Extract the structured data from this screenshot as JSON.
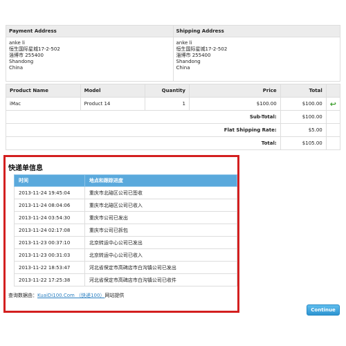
{
  "addresses": {
    "payment_header": "Payment Address",
    "shipping_header": "Shipping Address",
    "payment": [
      "anke li",
      "恒生国际星城17-2-502",
      "淄博市 255400",
      "Shandong",
      "China"
    ],
    "shipping": [
      "anke li",
      "恒生国际星城17-2-502",
      "淄博市 255400",
      "Shandong",
      "China"
    ]
  },
  "order": {
    "headers": {
      "product": "Product Name",
      "model": "Model",
      "quantity": "Quantity",
      "price": "Price",
      "total": "Total"
    },
    "item": {
      "product": "iMac",
      "model": "Product 14",
      "quantity": "1",
      "price": "$100.00",
      "total": "$100.00",
      "action_icon": "return-icon"
    },
    "totals": [
      {
        "label": "Sub-Total:",
        "value": "$100.00"
      },
      {
        "label": "Flat Shipping Rate:",
        "value": "$5.00"
      },
      {
        "label": "Total:",
        "value": "$105.00"
      }
    ]
  },
  "tracking": {
    "title": "快递单信息",
    "col_time": "时间",
    "col_progress": "地点和跟踪进度",
    "rows": [
      {
        "time": "2013-11-24 19:45:04",
        "status": "重庆市北碚区公司已签收"
      },
      {
        "time": "2013-11-24 08:04:06",
        "status": "重庆市北碚区公司已收入"
      },
      {
        "time": "2013-11-24 03:54:30",
        "status": "重庆市公司已发出"
      },
      {
        "time": "2013-11-24 02:17:08",
        "status": "重庆市公司已拆包"
      },
      {
        "time": "2013-11-23 00:37:10",
        "status": "北京转运中心公司已发出"
      },
      {
        "time": "2013-11-23 00:31:03",
        "status": "北京转运中心公司已收入"
      },
      {
        "time": "2013-11-22 18:53:47",
        "status": "河北省保定市高碑店市白沟镇公司已发出"
      },
      {
        "time": "2013-11-22 17:25:38",
        "status": "河北省保定市高碑店市白沟镇公司已收件"
      }
    ],
    "footnote_prefix": "查询数据由：",
    "footnote_link": "KuaiDi100.Com （快递100）",
    "footnote_suffix": "网站提供"
  },
  "buttons": {
    "continue": "Continue"
  },
  "colors": {
    "highlight_border": "#d31f1f",
    "tracking_header": "#5aa9dc",
    "button": "#2d93d0"
  }
}
